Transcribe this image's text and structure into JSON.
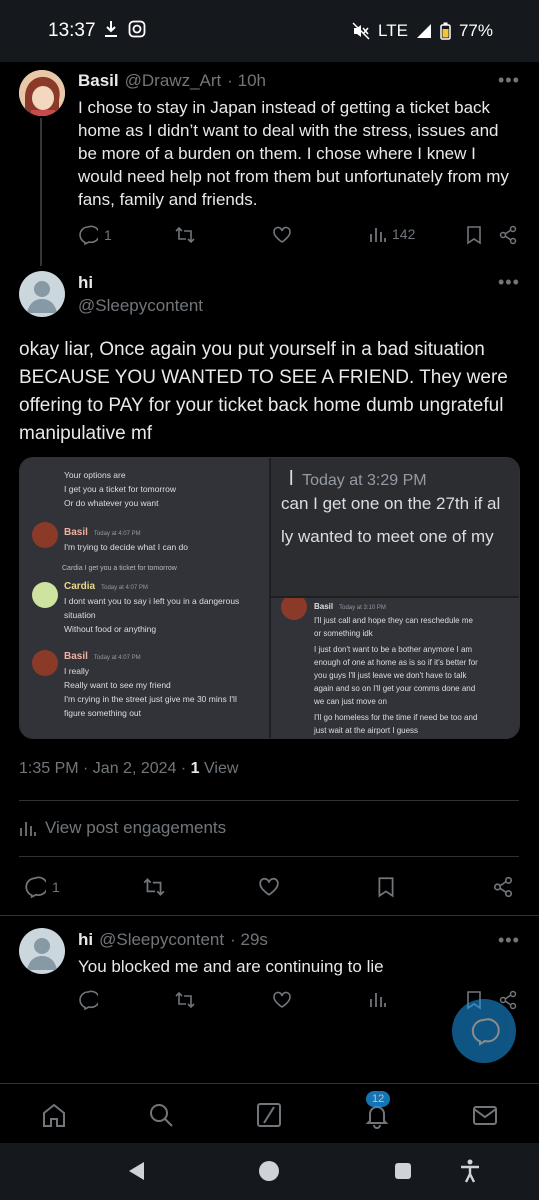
{
  "status_bar": {
    "time": "13:37",
    "network": "LTE",
    "battery": "77%"
  },
  "tweet1": {
    "name": "Basil",
    "handle": "@Drawz_Art",
    "time": "· 10h",
    "text": "I chose to stay in Japan instead of getting a ticket back home as I didn’t want to deal with the stress, issues and be more of a burden on them. I chose where I knew I would need help not from them but unfortunately from my fans, family and friends.",
    "replies": "1",
    "views": "142"
  },
  "tweet2": {
    "name": "hi",
    "handle": "@Sleepycontent",
    "text": "okay liar, Once again you put yourself in a bad situation BECAUSE YOU WANTED TO SEE A FRIEND. They were offering to PAY for your ticket back home dumb ungrateful manipulative mf",
    "timestamp": "1:35 PM · Jan 2, 2024 ·",
    "view_count": "1",
    "view_label": "View",
    "engagements": "View post engagements",
    "replies": "1"
  },
  "media": {
    "left": {
      "lines_top": [
        "Your options are",
        "I get you a ticket for tomorrow",
        "Or do whatever you want"
      ],
      "msg1_name": "Basil",
      "msg1_time": "Today at 4:07 PM",
      "msg1_text": "I'm trying to decide what I can do",
      "reply_ref": "Cardia  I get you a ticket for tomorrow",
      "msg2_name": "Cardia",
      "msg2_time": "Today at 4:07 PM",
      "msg2_lines": [
        "I dont want you to say i left you in a dangerous",
        "situation",
        "Without food or anything"
      ],
      "msg3_name": "Basil",
      "msg3_time": "Today at 4:07 PM",
      "msg3_lines": [
        "I really",
        "Really want to see my friend",
        "I'm crying in the street just give me 30 mins I'll",
        "figure something out"
      ]
    },
    "top_right": {
      "time": "Today at 3:29 PM",
      "line1": "can I get one on the 27th if al",
      "line2": "ly wanted to meet one of my"
    },
    "bottom_right": {
      "name": "Basil",
      "time": "Today at 3:10 PM",
      "lines": [
        "I'll just call and hope they can reschedule me",
        "or something idk",
        "I just don't want to be a bother anymore I am",
        "enough of one at home as is so if it's better for",
        "you guys I'll just leave we don't have to talk",
        "again and so on I'll get your comms done and",
        "we can just move on",
        "I'll go homeless for the time if need be too and",
        "just wait at the airport I guess"
      ]
    }
  },
  "reply": {
    "name": "hi",
    "handle": "@Sleepycontent",
    "time": "· 29s",
    "text": "You blocked me and are continuing to lie"
  },
  "nav": {
    "notification_count": "12"
  },
  "colors": {
    "accent": "#1d9bf0",
    "muted": "#71767b",
    "bg": "#000000"
  }
}
